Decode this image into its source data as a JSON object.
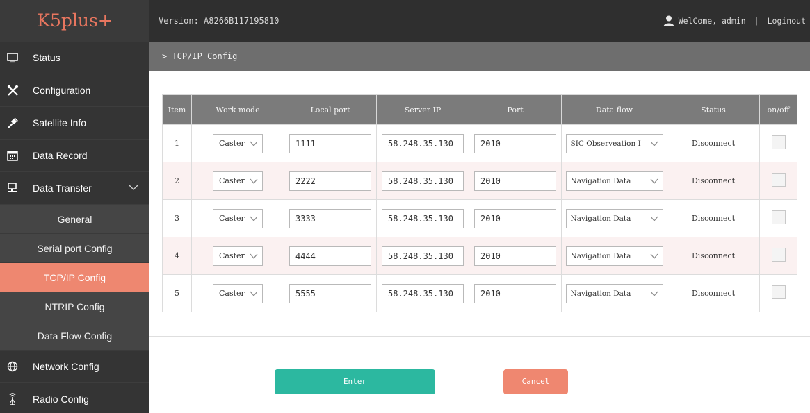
{
  "header": {
    "logo": "K5plus+",
    "version": "Version: A8266B117195810",
    "welcome": "WelCome, admin",
    "separator": "|",
    "logout": "Loginout"
  },
  "sidebar": {
    "items": [
      {
        "label": "Status",
        "icon": "monitor-icon"
      },
      {
        "label": "Configuration",
        "icon": "tools-icon"
      },
      {
        "label": "Satellite Info",
        "icon": "satellite-icon"
      },
      {
        "label": "Data Record",
        "icon": "calendar-icon"
      },
      {
        "label": "Data Transfer",
        "icon": "transfer-icon"
      }
    ],
    "subitems": [
      "General",
      "Serial port Config",
      "TCP/IP Config",
      "NTRIP Config",
      "Data Flow Config"
    ],
    "active_subitem": "TCP/IP Config",
    "bottom_items": [
      {
        "label": "Network Config",
        "icon": "globe-icon"
      },
      {
        "label": "Radio Config",
        "icon": "antenna-icon"
      }
    ]
  },
  "breadcrumb": "> TCP/IP Config",
  "table": {
    "headers": [
      "Item",
      "Work mode",
      "Local port",
      "Server IP",
      "Port",
      "Data flow",
      "Status",
      "on/off"
    ],
    "rows": [
      {
        "item": "1",
        "work_mode": "Caster",
        "local_port": "1111",
        "server_ip": "58.248.35.130",
        "port": "2010",
        "data_flow": "SIC Observeation I",
        "status": "Disconnect"
      },
      {
        "item": "2",
        "work_mode": "Caster",
        "local_port": "2222",
        "server_ip": "58.248.35.130",
        "port": "2010",
        "data_flow": "Navigation Data",
        "status": "Disconnect"
      },
      {
        "item": "3",
        "work_mode": "Caster",
        "local_port": "3333",
        "server_ip": "58.248.35.130",
        "port": "2010",
        "data_flow": "Navigation Data",
        "status": "Disconnect"
      },
      {
        "item": "4",
        "work_mode": "Caster",
        "local_port": "4444",
        "server_ip": "58.248.35.130",
        "port": "2010",
        "data_flow": "Navigation Data",
        "status": "Disconnect"
      },
      {
        "item": "5",
        "work_mode": "Caster",
        "local_port": "5555",
        "server_ip": "58.248.35.130",
        "port": "2010",
        "data_flow": "Navigation Data",
        "status": "Disconnect"
      }
    ]
  },
  "buttons": {
    "enter": "Enter",
    "cancel": "Cancel"
  },
  "colors": {
    "accent": "#ee8770",
    "enter": "#2cb8a0",
    "sidebar": "#343434"
  }
}
